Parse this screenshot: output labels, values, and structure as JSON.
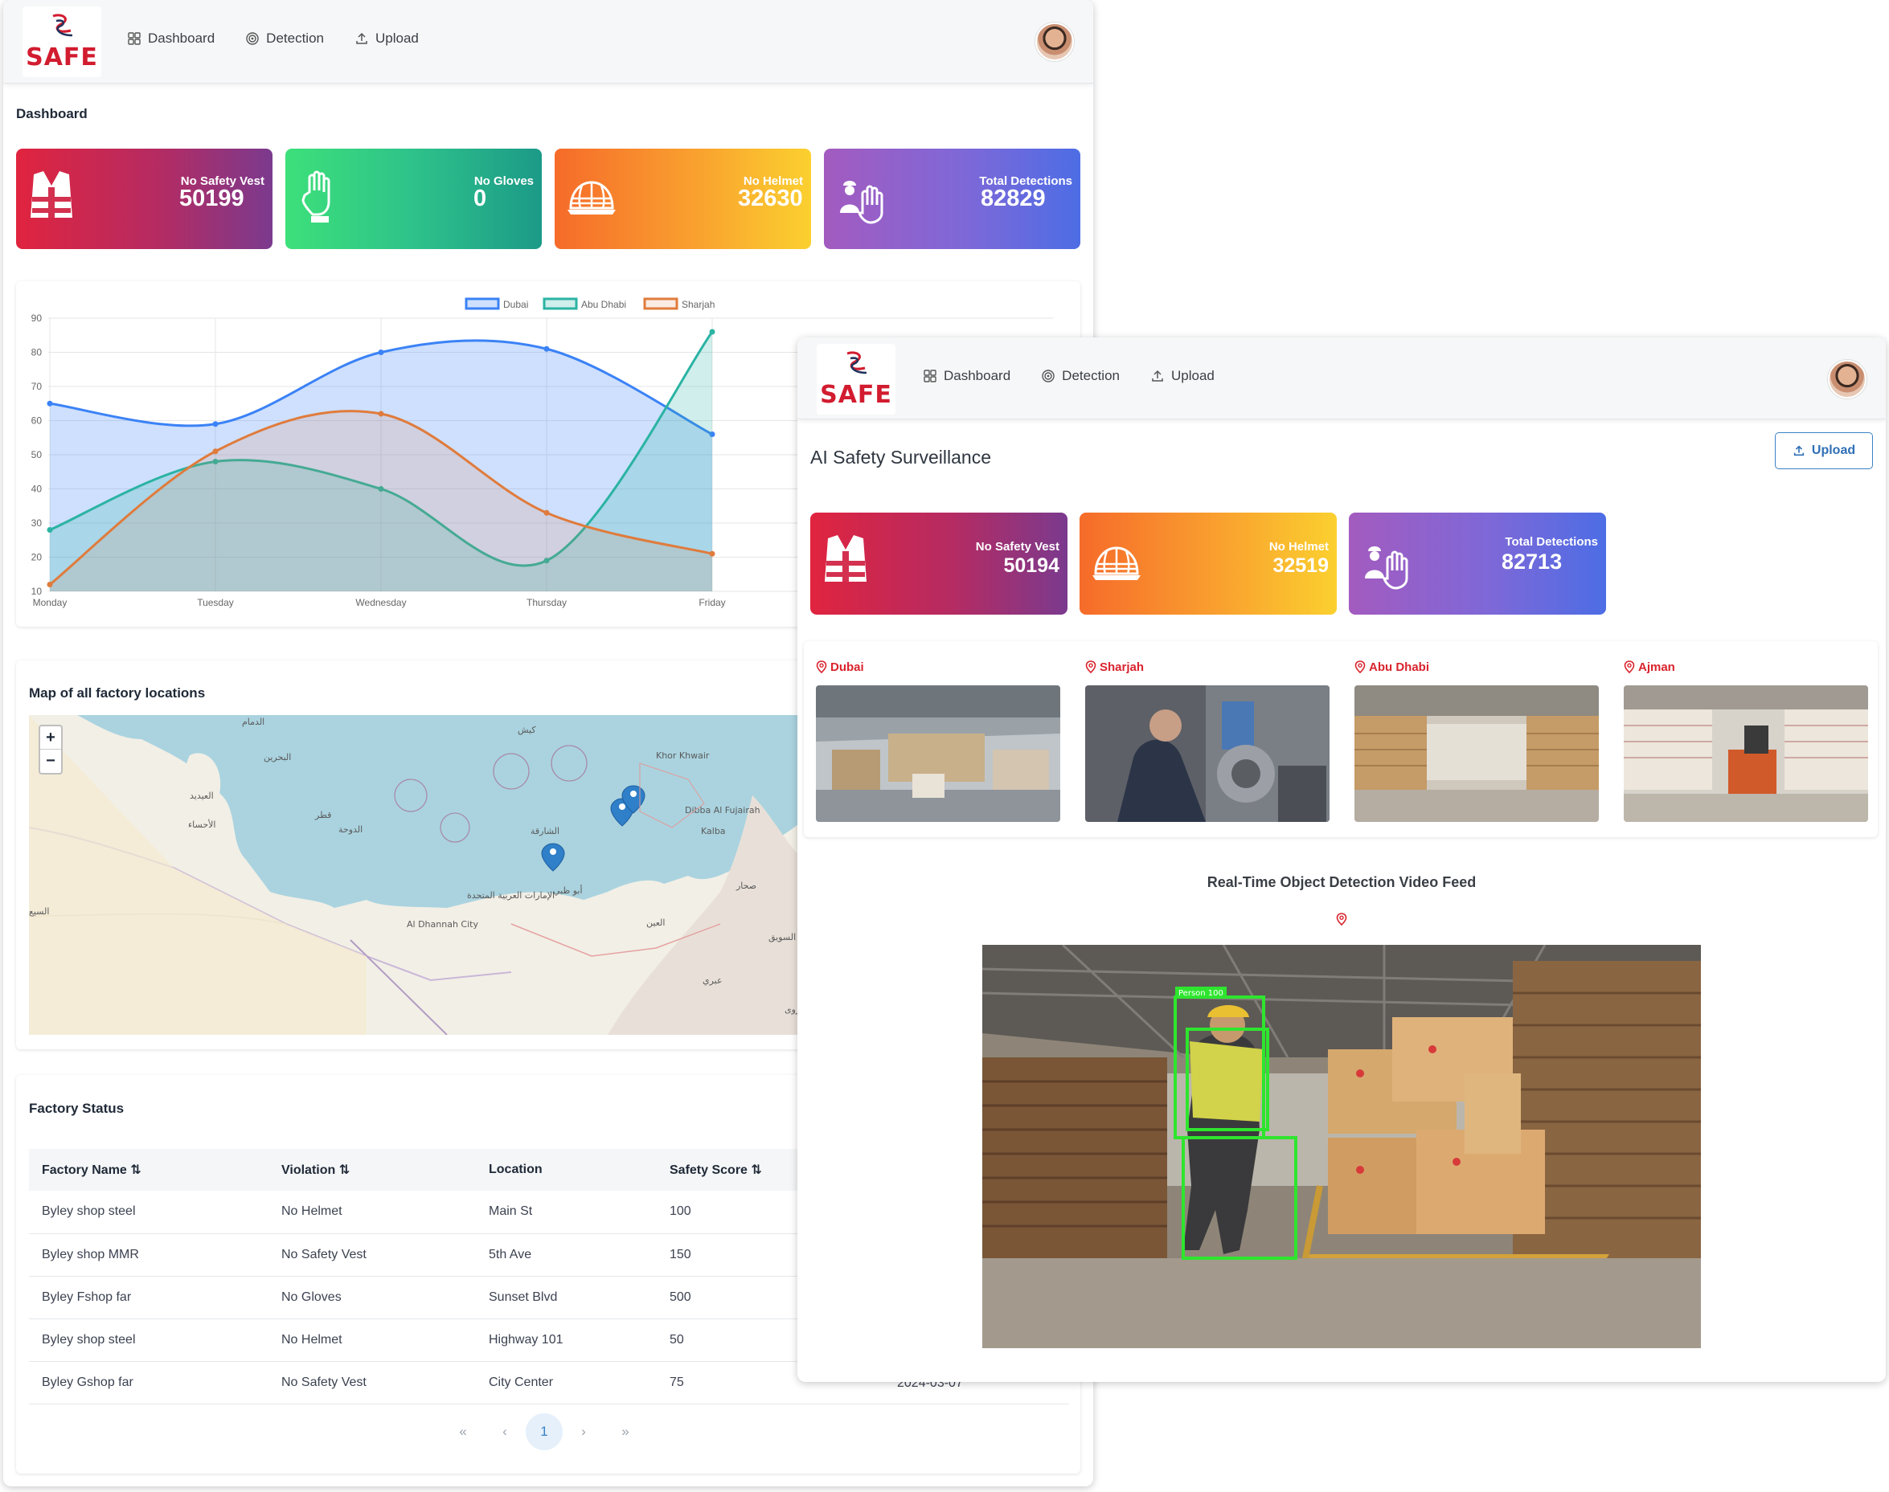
{
  "brand": {
    "logo_text": "SAFE",
    "red": "#d21c2f"
  },
  "nav": {
    "dashboard": "Dashboard",
    "detection": "Detection",
    "upload": "Upload"
  },
  "dashboard": {
    "title": "Dashboard",
    "cards": [
      {
        "label": "No Safety Vest",
        "value": "50199",
        "icon": "safety-vest-icon"
      },
      {
        "label": "No Gloves",
        "value": "0",
        "icon": "glove-icon"
      },
      {
        "label": "No Helmet",
        "value": "32630",
        "icon": "helmet-icon"
      },
      {
        "label": "Total Detections",
        "value": "82829",
        "icon": "worker-hand-icon"
      }
    ],
    "chart_data": {
      "type": "line",
      "categories": [
        "Monday",
        "Tuesday",
        "Wednesday",
        "Thursday",
        "Friday"
      ],
      "series": [
        {
          "name": "Dubai",
          "color": "#3b82f6",
          "values": [
            65,
            59,
            80,
            81,
            56
          ]
        },
        {
          "name": "Abu Dhabi",
          "color": "#2bb3a3",
          "values": [
            28,
            48,
            40,
            19,
            86
          ]
        },
        {
          "name": "Sharjah",
          "color": "#e07b3c",
          "values": [
            12,
            51,
            62,
            33,
            21
          ]
        }
      ],
      "yticks": [
        "90",
        "80",
        "70",
        "60",
        "50",
        "40",
        "30",
        "20",
        "10"
      ],
      "ylim": [
        10,
        90
      ],
      "legend": "top",
      "grid": true,
      "filled": true
    },
    "map": {
      "title": "Map of all factory locations",
      "zoom_in": "+",
      "zoom_out": "−",
      "labels": [
        "الدمام",
        "البحرين",
        "الدوحة",
        "قطر",
        "الأحساء",
        "العيديد",
        "كيش",
        "Khor Khwair",
        "Dibba Al Fujairah",
        "Kalba",
        "الشارقة",
        "الإمارات العربية المتحدة",
        "أبو ظبي",
        "Al Dhannah City",
        "العين",
        "السويق",
        "السيع",
        "صحار",
        "نزوى",
        "عبري"
      ]
    },
    "table": {
      "title": "Factory Status",
      "headers": [
        "Factory Name",
        "Violation",
        "Location",
        "Safety Score"
      ],
      "rows": [
        [
          "Byley shop steel",
          "No Helmet",
          "Main St",
          "100"
        ],
        [
          "Byley shop MMR",
          "No Safety Vest",
          "5th Ave",
          "150"
        ],
        [
          "Byley Fshop far",
          "No Gloves",
          "Sunset Blvd",
          "500"
        ],
        [
          "Byley shop steel",
          "No Helmet",
          "Highway 101",
          "50"
        ],
        [
          "Byley Gshop far",
          "No Safety Vest",
          "City Center",
          "75"
        ]
      ],
      "partial_date": "2024-03-07",
      "pager": {
        "first": "«",
        "prev": "‹",
        "page": "1",
        "next": "›",
        "last": "»"
      }
    }
  },
  "detection": {
    "title": "AI Safety Surveillance",
    "upload_button": "Upload",
    "cards": [
      {
        "label": "No Safety Vest",
        "value": "50194",
        "icon": "safety-vest-icon"
      },
      {
        "label": "No Helmet",
        "value": "32519",
        "icon": "helmet-icon"
      },
      {
        "label": "Total Detections",
        "value": "82713",
        "icon": "worker-hand-icon"
      }
    ],
    "locations": [
      "Dubai",
      "Sharjah",
      "Abu Dhabi",
      "Ajman"
    ],
    "feed_title": "Real-Time Object Detection Video Feed",
    "detection_tag": "Person 100"
  }
}
